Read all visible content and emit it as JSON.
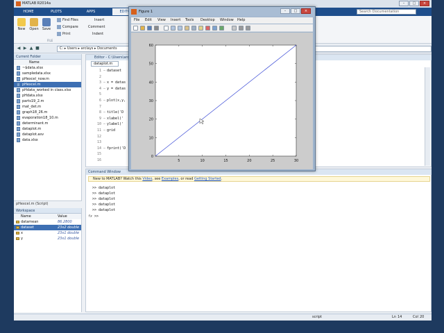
{
  "matlab": {
    "title": "MATLAB R2014a",
    "window_controls": [
      "–",
      "□",
      "×"
    ],
    "ribbon_tabs": [
      "HOME",
      "PLOTS",
      "APPS",
      "EDITOR"
    ],
    "search_placeholder": "Search Documentation",
    "ribbon": {
      "new": "New",
      "open": "Open",
      "save": "Save",
      "find_files": "Find Files",
      "compare": "Compare",
      "print": "Print",
      "insert": "Insert",
      "comment": "Comment",
      "indent": "Indent",
      "group_file": "FILE"
    },
    "path": {
      "segments": [
        "C:",
        "Users",
        "arclays",
        "Documents"
      ]
    },
    "current_folder": {
      "title": "Current Folder",
      "column": "Name",
      "files": [
        "~$data.xlsx",
        "sampledata.xlsx",
        "pHexcel_now.m",
        "pHexcel.m",
        "pHdata_worked in class.xlsx",
        "pHdata.xlsx",
        "parts19_2.m",
        "mat_det.m",
        "graph18_26.m",
        "evaporation18_10.m",
        "determinant.m",
        "dataplot.m",
        "dataplot.asv",
        "data.xlsx"
      ],
      "selected_index": 3,
      "details": "pHexcel.m (Script)"
    },
    "workspace": {
      "title": "Workspace",
      "col_name": "Name",
      "col_value": "Value",
      "vars": [
        {
          "name": "datamean",
          "value": "86.2800"
        },
        {
          "name": "dataset",
          "value": "23x2 double"
        },
        {
          "name": "x",
          "value": "23x1 double"
        },
        {
          "name": "y",
          "value": "23x1 double"
        }
      ],
      "selected_index": 1
    },
    "editor": {
      "title": "Editor - C:\\Users\\arcl",
      "tab": "dataplot.m",
      "lines": [
        {
          "n": "1",
          "mark": "—",
          "text": "dataset"
        },
        {
          "n": "2",
          "mark": "",
          "text": ""
        },
        {
          "n": "3",
          "mark": "—",
          "text": "x = datas"
        },
        {
          "n": "4",
          "mark": "—",
          "text": "y = datas"
        },
        {
          "n": "5",
          "mark": "",
          "text": ""
        },
        {
          "n": "6",
          "mark": "—",
          "text": "plot(x,y,"
        },
        {
          "n": "7",
          "mark": "",
          "text": ""
        },
        {
          "n": "8",
          "mark": "—",
          "text": "title('D"
        },
        {
          "n": "9",
          "mark": "—",
          "text": "xlabel('"
        },
        {
          "n": "10",
          "mark": "—",
          "text": "ylabel('"
        },
        {
          "n": "11",
          "mark": "—",
          "text": "grid"
        },
        {
          "n": "12",
          "mark": "",
          "text": ""
        },
        {
          "n": "13",
          "mark": "",
          "text": ""
        },
        {
          "n": "14",
          "mark": "—",
          "text": "fprint('D"
        },
        {
          "n": "15",
          "mark": "",
          "text": ""
        },
        {
          "n": "16",
          "mark": "",
          "text": ""
        }
      ]
    },
    "command_window": {
      "title": "Command Window",
      "info_prefix": "New to MATLAB? Watch this ",
      "info_video": "Video",
      "info_mid1": ", see ",
      "info_examples": "Examples",
      "info_mid2": ", or read ",
      "info_getting_started": "Getting Started",
      "info_end": ".",
      "history": [
        ">> dataplot",
        ">> dataplot",
        ">> dataplot",
        ">> dataplot",
        ">> dataplot"
      ],
      "prompt_fx": "fx",
      "prompt": ">>"
    },
    "status": {
      "left": "script",
      "ln_label": "Ln",
      "ln": "14",
      "col_label": "Col",
      "col": "20"
    }
  },
  "figure": {
    "title": "Figure 1",
    "menu": [
      "File",
      "Edit",
      "View",
      "Insert",
      "Tools",
      "Desktop",
      "Window",
      "Help"
    ],
    "toolbar_icons": [
      "new-figure-icon",
      "open-file-icon",
      "save-icon",
      "print-icon",
      "pointer-icon",
      "zoom-in-icon",
      "zoom-out-icon",
      "pan-icon",
      "rotate-icon",
      "data-cursor-icon",
      "brush-icon",
      "link-icon",
      "colorbar-icon",
      "legend-icon",
      "hide-tools-icon",
      "show-tools-icon"
    ]
  },
  "chart_data": {
    "type": "line",
    "title": "",
    "xlabel": "",
    "ylabel": "",
    "xlim": [
      0,
      30
    ],
    "ylim": [
      0,
      60
    ],
    "xticks": [
      5,
      10,
      15,
      20,
      25,
      30
    ],
    "yticks": [
      0,
      10,
      20,
      30,
      40,
      50,
      60
    ],
    "grid": false,
    "series": [
      {
        "color": "#3b4bd6",
        "x": [
          0,
          30
        ],
        "y": [
          0,
          60
        ]
      }
    ]
  }
}
